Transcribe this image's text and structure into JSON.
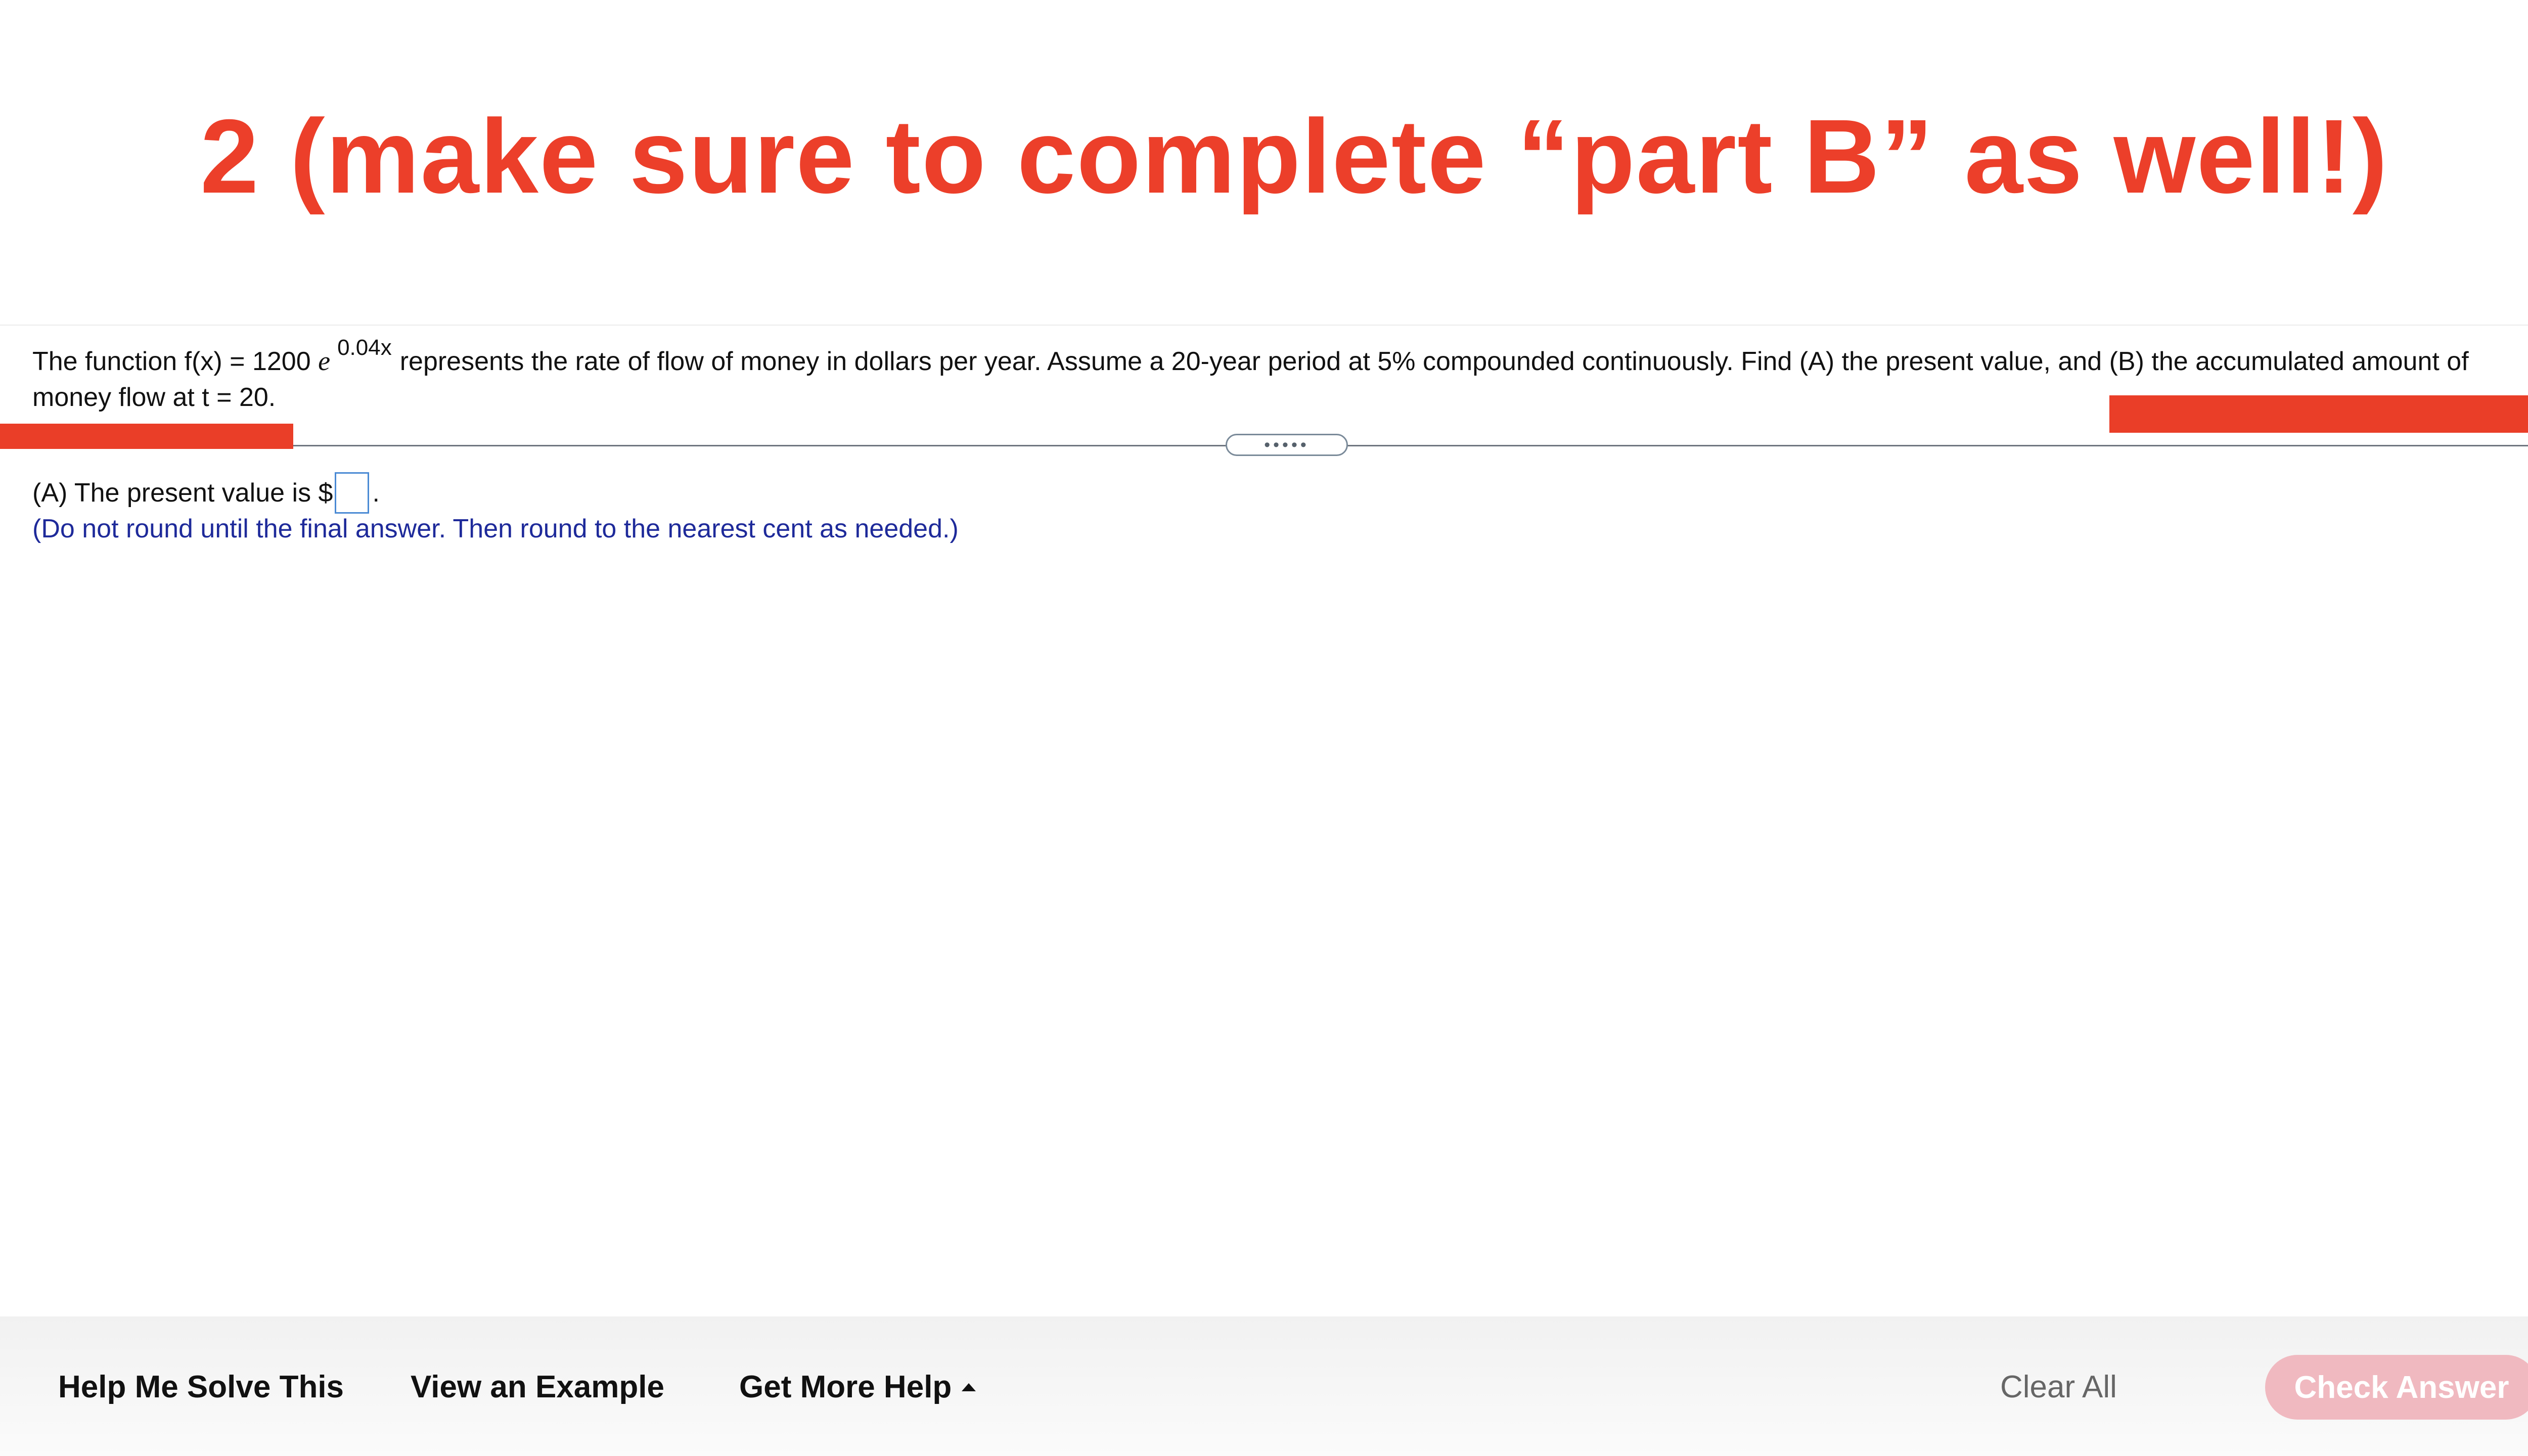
{
  "banner": {
    "text": "2 (make sure to complete “part B” as well!)"
  },
  "question": {
    "prefix": "The function f(x) = 1200 ",
    "e_symbol": "e",
    "exponent": "0.04x",
    "line1_rest": "represents the rate of flow of money in dollars per year.  Assume a 20-year period at 5% compounded continuously.  Find (A) the present value, and (B) the accumulated amount of",
    "line2": "money flow at t = 20."
  },
  "splitter": {
    "handle_label": "•••••"
  },
  "answer": {
    "prefix": "(A)  The present value is $",
    "suffix": ".",
    "input_value": "",
    "hint": "(Do not round until the final answer. Then round to the nearest cent as needed.)"
  },
  "footer": {
    "help_me_solve": "Help Me Solve This",
    "view_example": "View an Example",
    "get_more_help": "Get More Help",
    "clear_all": "Clear All",
    "check_answer": "Check Answer"
  },
  "colors": {
    "banner_red": "#ec3f2a",
    "hint_blue": "#1e2a9a",
    "input_border": "#4a8ad4",
    "check_answer_bg": "#f0b9c0"
  }
}
